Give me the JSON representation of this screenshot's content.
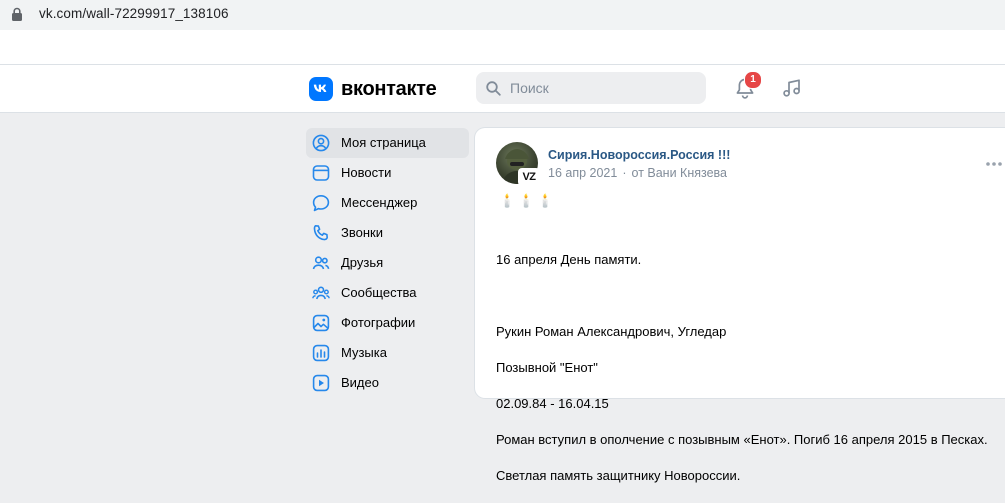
{
  "browser": {
    "url": "vk.com/wall-72299917_138106"
  },
  "header": {
    "logo_text": "вконтакте",
    "search_placeholder": "Поиск",
    "notifications_count": "1"
  },
  "sidebar": {
    "items": [
      {
        "label": "Моя страница",
        "icon": "user-circle-icon",
        "active": true
      },
      {
        "label": "Новости",
        "icon": "news-icon"
      },
      {
        "label": "Мессенджер",
        "icon": "message-icon"
      },
      {
        "label": "Звонки",
        "icon": "phone-icon"
      },
      {
        "label": "Друзья",
        "icon": "friends-icon"
      },
      {
        "label": "Сообщества",
        "icon": "communities-icon"
      },
      {
        "label": "Фотографии",
        "icon": "photo-icon"
      },
      {
        "label": "Музыка",
        "icon": "music-icon"
      },
      {
        "label": "Видео",
        "icon": "video-icon"
      }
    ]
  },
  "post": {
    "author": "Сирия.Новороссия.Россия !!!",
    "avatar_badge": "VZ",
    "date": "16 апр 2021",
    "signed_by": "от Вани Князева",
    "candles": "🕯️🕯️🕯️",
    "lines": [
      "16 апреля День памяти.",
      "",
      "Рукин Роман Александрович, Угледар",
      "Позывной \"Енот\"",
      "02.09.84 - 16.04.15",
      "Роман вступил в ополчение с позывным «Енот». Погиб 16 апреля 2015 в Песках.",
      "Светлая память защитнику Новороссии."
    ]
  },
  "colors": {
    "brand": "#0077ff",
    "link": "#2a5885",
    "badge": "#e64646",
    "background": "#edeef0"
  }
}
